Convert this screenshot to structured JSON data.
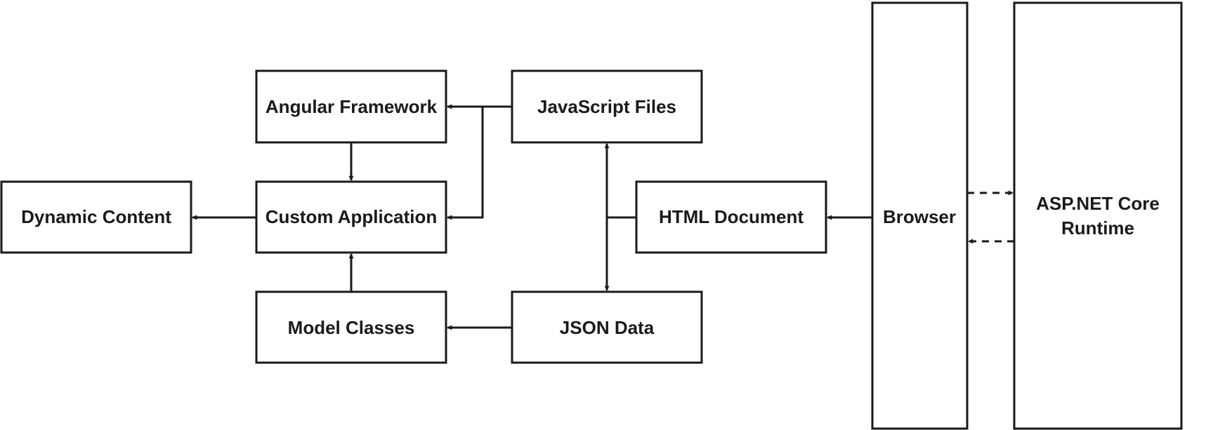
{
  "nodes": {
    "angular_framework": "Angular Framework",
    "javascript_files": "JavaScript Files",
    "dynamic_content": "Dynamic Content",
    "custom_application": "Custom Application",
    "html_document": "HTML Document",
    "model_classes": "Model Classes",
    "json_data": "JSON Data",
    "browser": "Browser",
    "aspnet_line1": "ASP.NET Core",
    "aspnet_line2": "Runtime"
  }
}
